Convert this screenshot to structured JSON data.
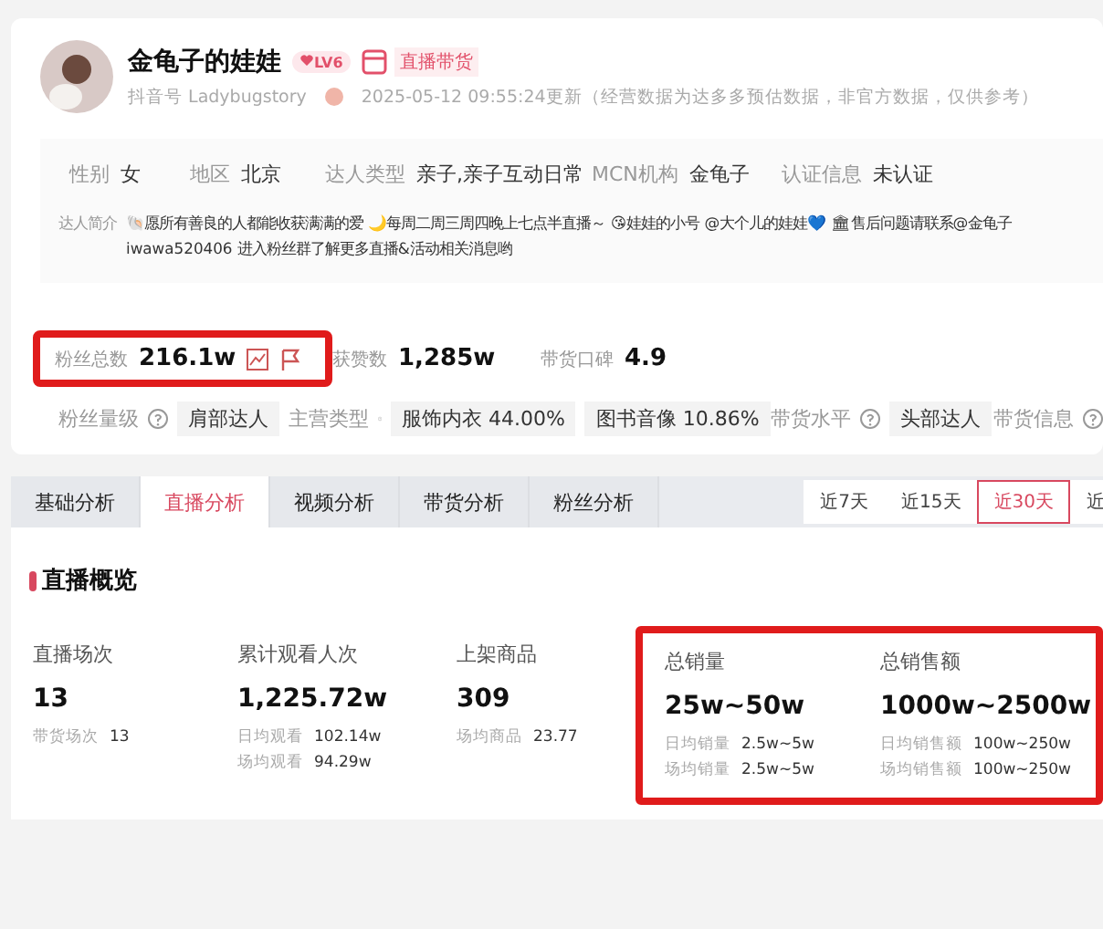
{
  "profile": {
    "name": "金龟子的娃娃",
    "level_badge": "LV6",
    "live_tag": "直播带货",
    "account_id": "抖音号 Ladybugstory",
    "update_note": "2025-05-12 09:55:24更新（经营数据为达多多预估数据，非官方数据，仅供参考）",
    "info": [
      {
        "label": "性别",
        "value": "女"
      },
      {
        "label": "地区",
        "value": "北京"
      },
      {
        "label": "达人类型",
        "value": "亲子,亲子互动日常"
      },
      {
        "label": "MCN机构",
        "value": "金龟子"
      },
      {
        "label": "认证信息",
        "value": "未认证"
      }
    ],
    "bio_label": "达人简介",
    "bio": [
      "🐚愿所有善良的人都能收获满满的爱 🌙每周二周三周四晚上七点半直播～ 😘娃娃的小号 @大个儿的娃娃💙 🏛售后问题请联系@金龟子",
      "iwawa520406 进入粉丝群了解更多直播&活动相关消息哟"
    ],
    "stats": [
      {
        "label": "粉丝总数",
        "value": "216.1w",
        "highlighted": true,
        "has_actions": true
      },
      {
        "label": "获赞数",
        "value": "1,285w",
        "highlighted": false,
        "has_actions": false
      },
      {
        "label": "带货口碑",
        "value": "4.9",
        "highlighted": false,
        "has_actions": false
      }
    ],
    "tags": [
      {
        "label": "粉丝量级",
        "chips": [
          "肩部达人"
        ]
      },
      {
        "label": "主营类型",
        "chips": [
          "服饰内衣 44.00%",
          "图书音像 10.86%"
        ]
      },
      {
        "label": "带货水平",
        "chips": [
          "头部达人"
        ]
      },
      {
        "label": "带货信息"
      }
    ]
  },
  "tabs": [
    {
      "label": "基础分析",
      "selected": false
    },
    {
      "label": "直播分析",
      "selected": true
    },
    {
      "label": "视频分析",
      "selected": false
    },
    {
      "label": "带货分析",
      "selected": false
    },
    {
      "label": "粉丝分析",
      "selected": false
    }
  ],
  "ranges": [
    {
      "label": "近7天",
      "selected": false
    },
    {
      "label": "近15天",
      "selected": false
    },
    {
      "label": "近30天",
      "selected": true
    },
    {
      "label": "近",
      "selected": false
    }
  ],
  "live": {
    "title": "直播概览",
    "metrics": [
      {
        "label": "直播场次",
        "value": "13",
        "highlighted": false,
        "subs": [
          {
            "label": "带货场次",
            "value": "13"
          }
        ]
      },
      {
        "label": "累计观看人次",
        "value": "1,225.72w",
        "highlighted": false,
        "subs": [
          {
            "label": "日均观看",
            "value": "102.14w"
          },
          {
            "label": "场均观看",
            "value": "94.29w"
          }
        ]
      },
      {
        "label": "上架商品",
        "value": "309",
        "highlighted": false,
        "subs": [
          {
            "label": "场均商品",
            "value": "23.77"
          }
        ]
      },
      {
        "label": "总销量",
        "value": "25w~50w",
        "highlighted": true,
        "subs": [
          {
            "label": "日均销量",
            "value": "2.5w~5w"
          },
          {
            "label": "场均销量",
            "value": "2.5w~5w"
          }
        ]
      },
      {
        "label": "总销售额",
        "value": "1000w~2500w",
        "highlighted": true,
        "subs": [
          {
            "label": "日均销售额",
            "value": "100w~250w"
          },
          {
            "label": "场均销售额",
            "value": "100w~250w"
          }
        ]
      }
    ]
  }
}
